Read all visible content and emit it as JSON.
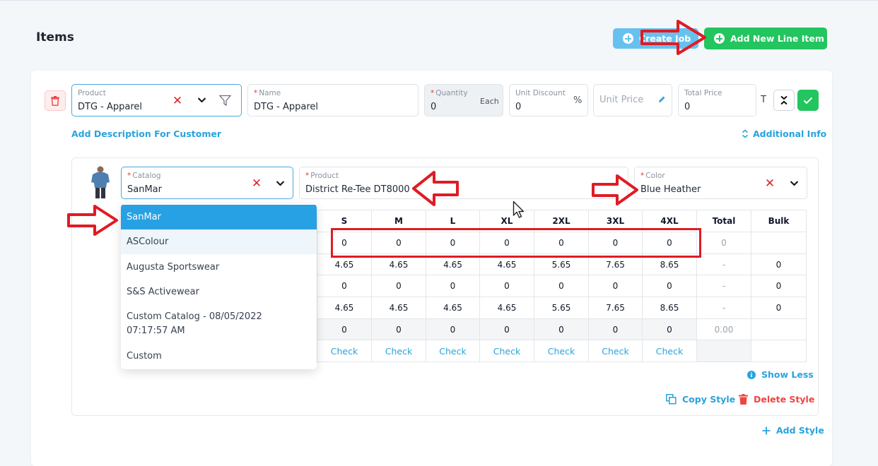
{
  "header": {
    "title": "Items"
  },
  "buttons": {
    "create_job": "Create Job",
    "add_line_item": "Add New Line Item"
  },
  "line_item": {
    "product": {
      "label": "Product",
      "value": "DTG - Apparel"
    },
    "name": {
      "label": "Name",
      "value": "DTG - Apparel"
    },
    "quantity": {
      "label": "Quantity",
      "value": "0",
      "unit": "Each"
    },
    "unit_discount": {
      "label": "Unit Discount",
      "value": "0",
      "suffix": "%"
    },
    "unit_price": {
      "placeholder": "Unit Price"
    },
    "total_price": {
      "label": "Total Price",
      "value": "0"
    },
    "t_label": "T",
    "add_description": "Add Description For Customer",
    "additional_info": "Additional Info"
  },
  "style": {
    "catalog": {
      "label": "Catalog",
      "value": "SanMar"
    },
    "product": {
      "label": "Product",
      "value": "District Re-Tee DT8000"
    },
    "color": {
      "label": "Color",
      "value": "Blue Heather"
    }
  },
  "catalog_options": [
    "SanMar",
    "ASColour",
    "Augusta Sportswear",
    "S&S Activewear",
    "Custom Catalog - 08/05/2022 07:17:57 AM",
    "Custom"
  ],
  "size_grid": {
    "headers": [
      "S",
      "M",
      "L",
      "XL",
      "2XL",
      "3XL",
      "4XL",
      "Total",
      "Bulk"
    ],
    "rows": [
      [
        "0",
        "0",
        "0",
        "0",
        "0",
        "0",
        "0",
        "0",
        ""
      ],
      [
        "4.65",
        "4.65",
        "4.65",
        "4.65",
        "5.65",
        "7.65",
        "8.65",
        "-",
        "0"
      ],
      [
        "0",
        "0",
        "0",
        "0",
        "0",
        "0",
        "0",
        "-",
        "0"
      ],
      [
        "4.65",
        "4.65",
        "4.65",
        "4.65",
        "5.65",
        "7.65",
        "8.65",
        "-",
        "0"
      ],
      [
        "0",
        "0",
        "0",
        "0",
        "0",
        "0",
        "0",
        "0.00",
        ""
      ],
      [
        "Check",
        "Check",
        "Check",
        "Check",
        "Check",
        "Check",
        "Check",
        "",
        ""
      ]
    ]
  },
  "actions": {
    "show_less": "Show Less",
    "copy_style": "Copy Style",
    "delete_style": "Delete Style",
    "add_style": "Add Style"
  },
  "colors": {
    "accent_blue": "#29a3dc",
    "green": "#22c55e",
    "light_blue": "#67c1ef",
    "danger": "#ef4444",
    "annotation_red": "#e01b24"
  }
}
